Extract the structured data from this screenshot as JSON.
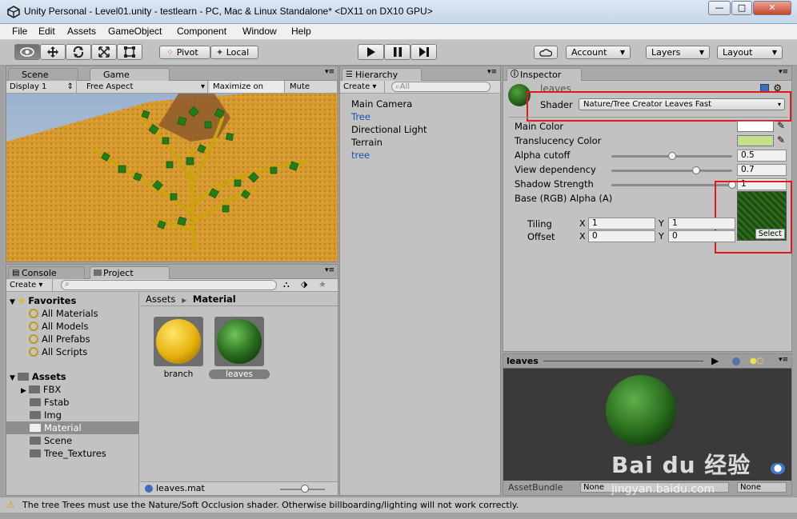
{
  "window": {
    "title": "Unity Personal - Level01.unity - testlearn - PC, Mac & Linux Standalone* <DX11 on DX10 GPU>",
    "min": "—",
    "max": "□",
    "close": "✕"
  },
  "menu": [
    "File",
    "Edit",
    "Assets",
    "GameObject",
    "Component",
    "Window",
    "Help"
  ],
  "toolbar": {
    "pivot": "Pivot",
    "local": "Local",
    "account": "Account",
    "layers": "Layers",
    "layout": "Layout"
  },
  "scene_tabs": {
    "scene": "Scene",
    "game": "Game"
  },
  "game_bar": {
    "display": "Display 1",
    "aspect": "Free Aspect",
    "maximize": "Maximize on Play",
    "mute": "Mute audio"
  },
  "hierarchy": {
    "tab": "Hierarchy",
    "create": "Create",
    "search_placeholder": "All",
    "items": [
      {
        "label": "Main Camera",
        "color": "#000000"
      },
      {
        "label": "Tree",
        "color": "#1a4fb3"
      },
      {
        "label": "Directional Light",
        "color": "#000000"
      },
      {
        "label": "Terrain",
        "color": "#000000"
      },
      {
        "label": "tree",
        "color": "#1a4fb3"
      }
    ]
  },
  "inspector": {
    "tab": "Inspector",
    "name": "leaves",
    "shader_label": "Shader",
    "shader_value": "Nature/Tree Creator Leaves Fast",
    "main_color": "Main Color",
    "translucency": "Translucency Color",
    "main_color_hex": "#ffffff",
    "translucency_hex": "#c3e08a",
    "alpha_cutoff": {
      "label": "Alpha cutoff",
      "value": "0.5",
      "level": 0.5
    },
    "view_dependency": {
      "label": "View dependency",
      "value": "0.7",
      "level": 0.7
    },
    "shadow_strength": {
      "label": "Shadow Strength",
      "value": "1",
      "level": 1.0
    },
    "base_label": "Base (RGB) Alpha (A)",
    "tiling": "Tiling",
    "offset": "Offset",
    "x": "X",
    "y": "Y",
    "tiling_x": "1",
    "tiling_y": "1",
    "offset_x": "0",
    "offset_y": "0",
    "select": "Select"
  },
  "preview": {
    "title": "leaves",
    "assetbundle": "AssetBundle",
    "none1": "None",
    "none2": "None"
  },
  "console_tab": "Console",
  "project": {
    "tab": "Project",
    "create": "Create",
    "favorites": "Favorites",
    "fav_items": [
      "All Materials",
      "All Models",
      "All Prefabs",
      "All Scripts"
    ],
    "assets": "Assets",
    "folders": [
      "FBX",
      "Fstab",
      "Img",
      "Material",
      "Scene",
      "Tree_Textures"
    ],
    "breadcrumb_root": "Assets",
    "breadcrumb_current": "Material",
    "files": [
      "branch",
      "leaves"
    ],
    "status_file": "leaves.mat"
  },
  "status_bar": "The tree Trees must use the Nature/Soft Occlusion shader. Otherwise billboarding/lighting will not work correctly.",
  "watermark": {
    "brand": "Bai du 经验",
    "url": "jingyan.baidu.com"
  }
}
